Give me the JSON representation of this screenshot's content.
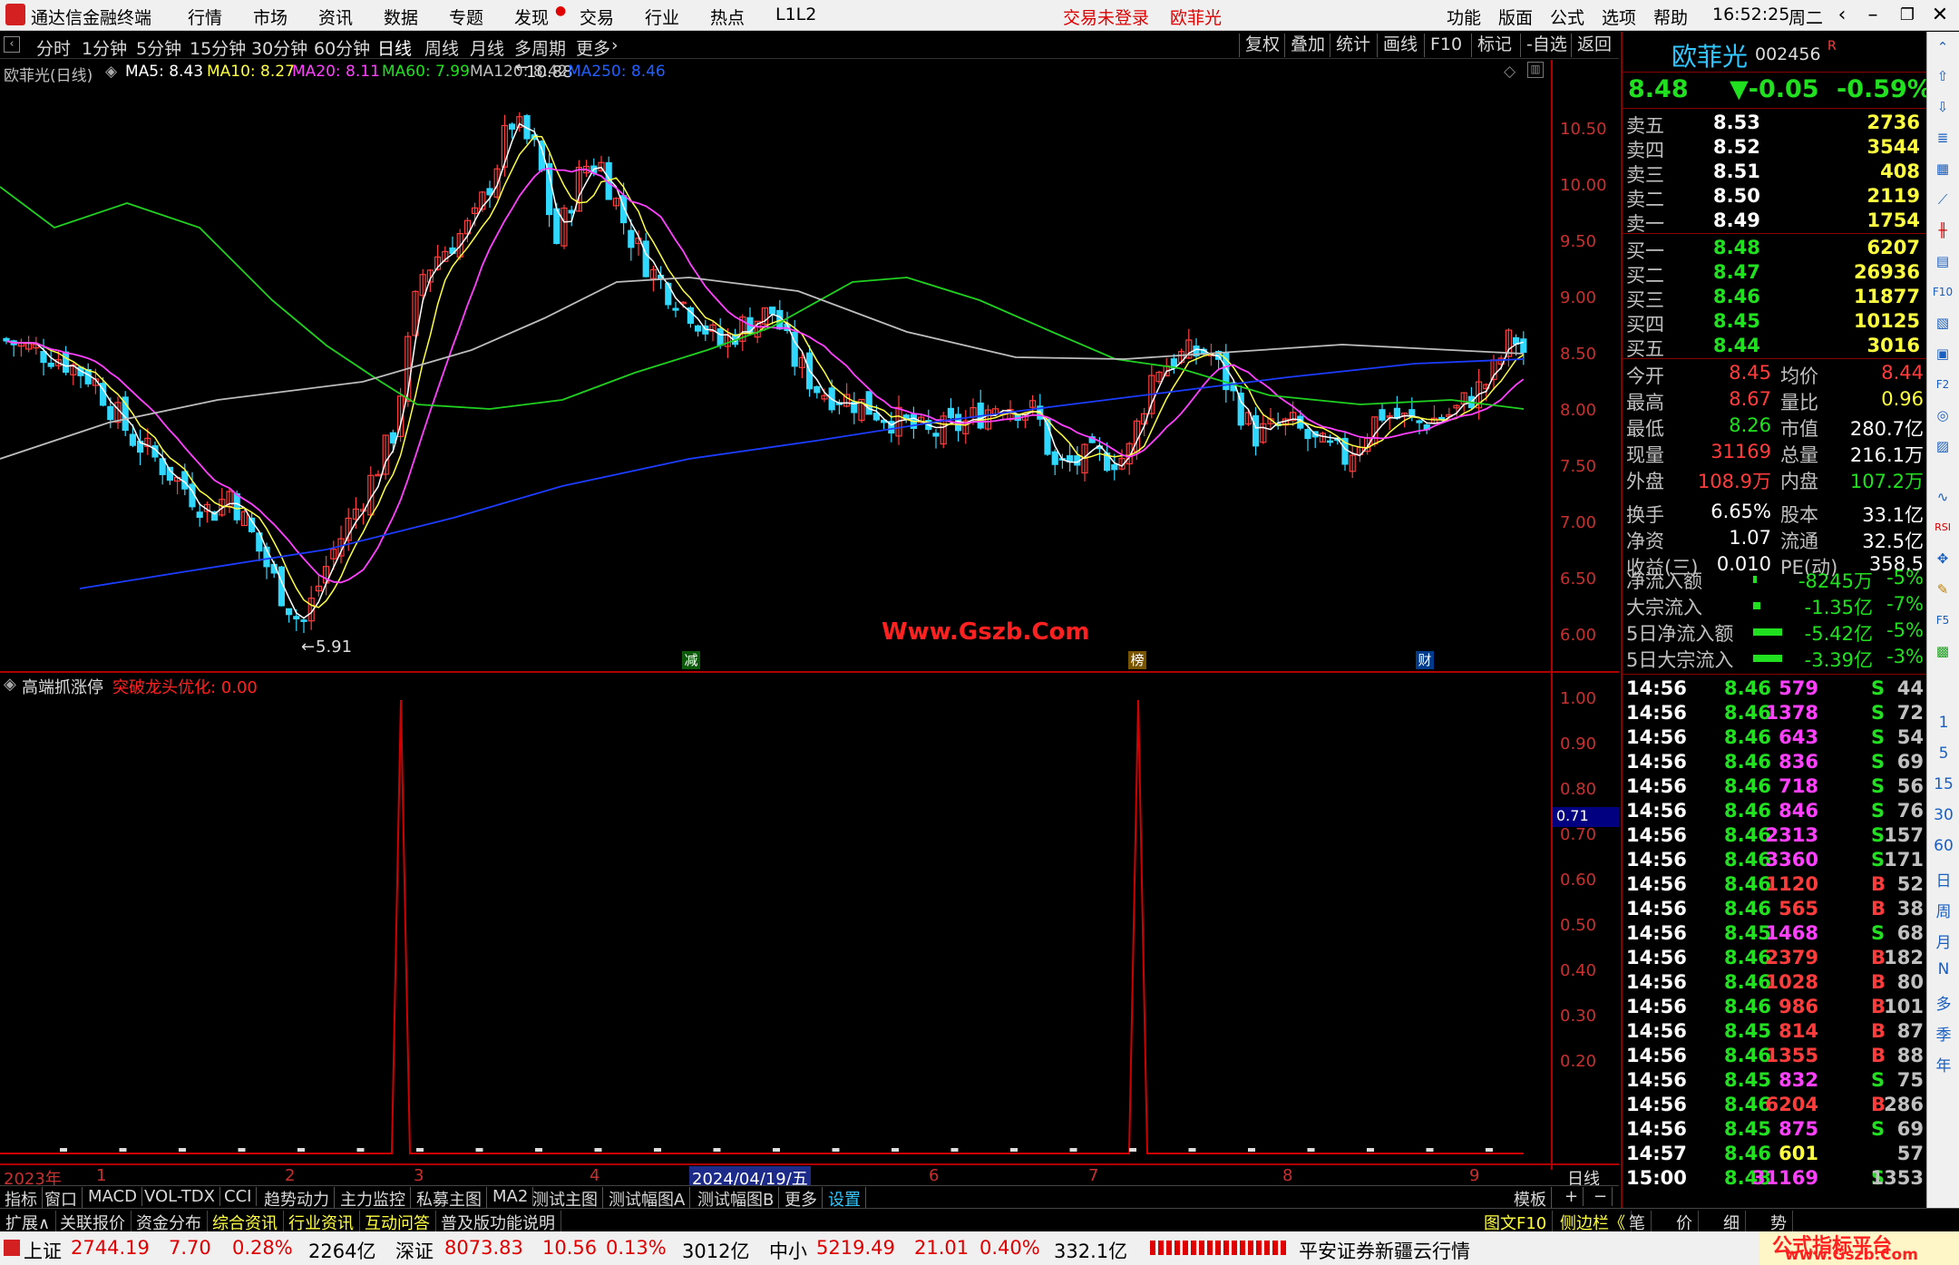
{
  "titlebar": {
    "app_title": "通达信金融终端",
    "menu": [
      "行情",
      "市场",
      "资讯",
      "数据",
      "专题",
      "发现",
      "交易",
      "行业",
      "热点",
      "L1L2"
    ],
    "login_status": "交易未登录",
    "stock_name": "欧菲光",
    "right_menu": [
      "功能",
      "版面",
      "公式",
      "选项",
      "帮助"
    ],
    "time": "16:52:25",
    "weekday": "周二"
  },
  "periods": [
    "分时",
    "1分钟",
    "5分钟",
    "15分钟",
    "30分钟",
    "60分钟",
    "日线",
    "周线",
    "月线",
    "多周期",
    "更多"
  ],
  "active_period": "日线",
  "chart_toolbar": [
    "复权",
    "叠加",
    "统计",
    "画线",
    "F10",
    "标记",
    "-自选",
    "返回"
  ],
  "ma_legend": {
    "title": "欧菲光(日线)",
    "items": [
      {
        "label": "MA5: 8.43",
        "color": "#ffffff"
      },
      {
        "label": "MA10: 8.27",
        "color": "#ffff40"
      },
      {
        "label": "MA20: 8.11",
        "color": "#ff40ff"
      },
      {
        "label": "MA60: 7.99",
        "color": "#20e020"
      },
      {
        "label": "MA120: 8.42",
        "color": "#c0c0c0"
      },
      {
        "label": "MA250: 8.46",
        "color": "#2060ff"
      }
    ]
  },
  "price_annotations": {
    "high": "10.88",
    "low": "5.91"
  },
  "y_axis_main": [
    "10.50",
    "10.00",
    "9.50",
    "9.00",
    "8.50",
    "8.00",
    "7.50",
    "7.00",
    "6.50",
    "6.00"
  ],
  "y_axis_sub": [
    "1.00",
    "0.90",
    "0.80",
    "0.70",
    "0.60",
    "0.50",
    "0.40",
    "0.30",
    "0.20"
  ],
  "sub_value_tag": "0.71",
  "event_markers": [
    "减",
    "榜",
    "财"
  ],
  "watermark": "Www.Gszb.Com",
  "sub_indicator": {
    "name": "高端抓涨停",
    "param": "突破龙头优化: 0.00"
  },
  "x_axis": [
    "2023年",
    "1",
    "2",
    "3",
    "4",
    "2024/04/19/五",
    "6",
    "7",
    "8",
    "9",
    "日线"
  ],
  "tabs_row1": [
    "指标",
    "窗口",
    "MACD",
    "VOL-TDX",
    "CCI",
    "趋势动力",
    "主力监控",
    "私募主图",
    "MA2",
    "测试主图",
    "测试幅图A",
    "测试幅图B",
    "更多",
    "设置"
  ],
  "tabs_row1_right": [
    "模板",
    "+",
    "−"
  ],
  "tabs_row2": [
    "扩展∧",
    "关联报价",
    "资金分布",
    "综合资讯",
    "行业资讯",
    "互动问答",
    "普及版功能说明"
  ],
  "tabs_row2_right": [
    "图文F10",
    "侧边栏《",
    "笔",
    "价",
    "细",
    "势"
  ],
  "quote": {
    "name": "欧菲光",
    "code": "002456",
    "flag": "R",
    "price": "8.48",
    "change": "▼-0.05",
    "pct": "-0.59%",
    "asks": [
      {
        "label": "卖五",
        "price": "8.53",
        "vol": "2736"
      },
      {
        "label": "卖四",
        "price": "8.52",
        "vol": "3544"
      },
      {
        "label": "卖三",
        "price": "8.51",
        "vol": "408"
      },
      {
        "label": "卖二",
        "price": "8.50",
        "vol": "2119"
      },
      {
        "label": "卖一",
        "price": "8.49",
        "vol": "1754"
      }
    ],
    "bids": [
      {
        "label": "买一",
        "price": "8.48",
        "vol": "6207"
      },
      {
        "label": "买二",
        "price": "8.47",
        "vol": "26936"
      },
      {
        "label": "买三",
        "price": "8.46",
        "vol": "11877"
      },
      {
        "label": "买四",
        "price": "8.45",
        "vol": "10125"
      },
      {
        "label": "买五",
        "price": "8.44",
        "vol": "3016"
      }
    ],
    "stats": [
      {
        "l1": "今开",
        "v1": "8.45",
        "l2": "均价",
        "v2": "8.44",
        "c1": "#ff3c3c",
        "c2": "#ff3c3c"
      },
      {
        "l1": "最高",
        "v1": "8.67",
        "l2": "量比",
        "v2": "0.96",
        "c1": "#ff3c3c",
        "c2": "#ffff40"
      },
      {
        "l1": "最低",
        "v1": "8.26",
        "l2": "市值",
        "v2": "280.7亿",
        "c1": "#20e020",
        "c2": "#ffffff"
      },
      {
        "l1": "现量",
        "v1": "31169",
        "l2": "总量",
        "v2": "216.1万",
        "c1": "#ff3c3c",
        "c2": "#ffffff"
      },
      {
        "l1": "外盘",
        "v1": "108.9万",
        "l2": "内盘",
        "v2": "107.2万",
        "c1": "#ff3c3c",
        "c2": "#20e020"
      },
      {
        "l1": "换手",
        "v1": "6.65%",
        "l2": "股本",
        "v2": "33.1亿",
        "c1": "#ffffff",
        "c2": "#ffffff"
      },
      {
        "l1": "净资",
        "v1": "1.07",
        "l2": "流通",
        "v2": "32.5亿",
        "c1": "#ffffff",
        "c2": "#ffffff"
      },
      {
        "l1": "收益(三)",
        "v1": "0.010",
        "l2": "PE(动)",
        "v2": "358.5",
        "c1": "#ffffff",
        "c2": "#ffffff"
      }
    ],
    "flows": [
      {
        "label": "净流入额",
        "value": "-8245万",
        "pct": "-5%"
      },
      {
        "label": "大宗流入",
        "value": "-1.35亿",
        "pct": "-7%"
      },
      {
        "label": "5日净流入额",
        "value": "-5.42亿",
        "pct": "-5%"
      },
      {
        "label": "5日大宗流入",
        "value": "-3.39亿",
        "pct": "-3%"
      }
    ]
  },
  "ticks": [
    {
      "t": "14:56",
      "p": "8.46",
      "v": "579",
      "s": "S",
      "n": "44"
    },
    {
      "t": "14:56",
      "p": "8.46",
      "v": "1378",
      "s": "S",
      "n": "72"
    },
    {
      "t": "14:56",
      "p": "8.46",
      "v": "643",
      "s": "S",
      "n": "54"
    },
    {
      "t": "14:56",
      "p": "8.46",
      "v": "836",
      "s": "S",
      "n": "69"
    },
    {
      "t": "14:56",
      "p": "8.46",
      "v": "718",
      "s": "S",
      "n": "56"
    },
    {
      "t": "14:56",
      "p": "8.46",
      "v": "846",
      "s": "S",
      "n": "76"
    },
    {
      "t": "14:56",
      "p": "8.46",
      "v": "2313",
      "s": "S",
      "n": "157"
    },
    {
      "t": "14:56",
      "p": "8.46",
      "v": "3360",
      "s": "S",
      "n": "171"
    },
    {
      "t": "14:56",
      "p": "8.46",
      "v": "1120",
      "s": "B",
      "n": "52"
    },
    {
      "t": "14:56",
      "p": "8.46",
      "v": "565",
      "s": "B",
      "n": "38"
    },
    {
      "t": "14:56",
      "p": "8.45",
      "v": "1468",
      "s": "S",
      "n": "68"
    },
    {
      "t": "14:56",
      "p": "8.46",
      "v": "2379",
      "s": "B",
      "n": "182"
    },
    {
      "t": "14:56",
      "p": "8.46",
      "v": "1028",
      "s": "B",
      "n": "80"
    },
    {
      "t": "14:56",
      "p": "8.46",
      "v": "986",
      "s": "B",
      "n": "101"
    },
    {
      "t": "14:56",
      "p": "8.45",
      "v": "814",
      "s": "B",
      "n": "87"
    },
    {
      "t": "14:56",
      "p": "8.46",
      "v": "1355",
      "s": "B",
      "n": "88"
    },
    {
      "t": "14:56",
      "p": "8.45",
      "v": "832",
      "s": "S",
      "n": "75"
    },
    {
      "t": "14:56",
      "p": "8.46",
      "v": "6204",
      "s": "B",
      "n": "286"
    },
    {
      "t": "14:56",
      "p": "8.45",
      "v": "875",
      "s": "S",
      "n": "69"
    },
    {
      "t": "14:57",
      "p": "8.46",
      "v": "601",
      "s": "",
      "n": "57"
    },
    {
      "t": "15:00",
      "p": "8.48",
      "v": "31169",
      "s": "S",
      "n": "1353"
    }
  ],
  "side_periods": [
    "1",
    "5",
    "15",
    "30",
    "60",
    "日",
    "周",
    "月",
    "N",
    "多",
    "季",
    "年"
  ],
  "statusbar": {
    "indexes": [
      {
        "name": "上证",
        "value": "2744.19",
        "chg": "7.70",
        "pct": "0.28%",
        "amt": "2264亿"
      },
      {
        "name": "深证",
        "value": "8073.83",
        "chg": "10.56",
        "pct": "0.13%",
        "amt": "3012亿"
      },
      {
        "name": "中小",
        "value": "5219.49",
        "chg": "21.01",
        "pct": "0.40%",
        "amt": "332.1亿"
      }
    ],
    "broker": "平安证券新疆云行情",
    "brand": "公式指标平台",
    "brand_url": "www.Gszb.Com"
  }
}
